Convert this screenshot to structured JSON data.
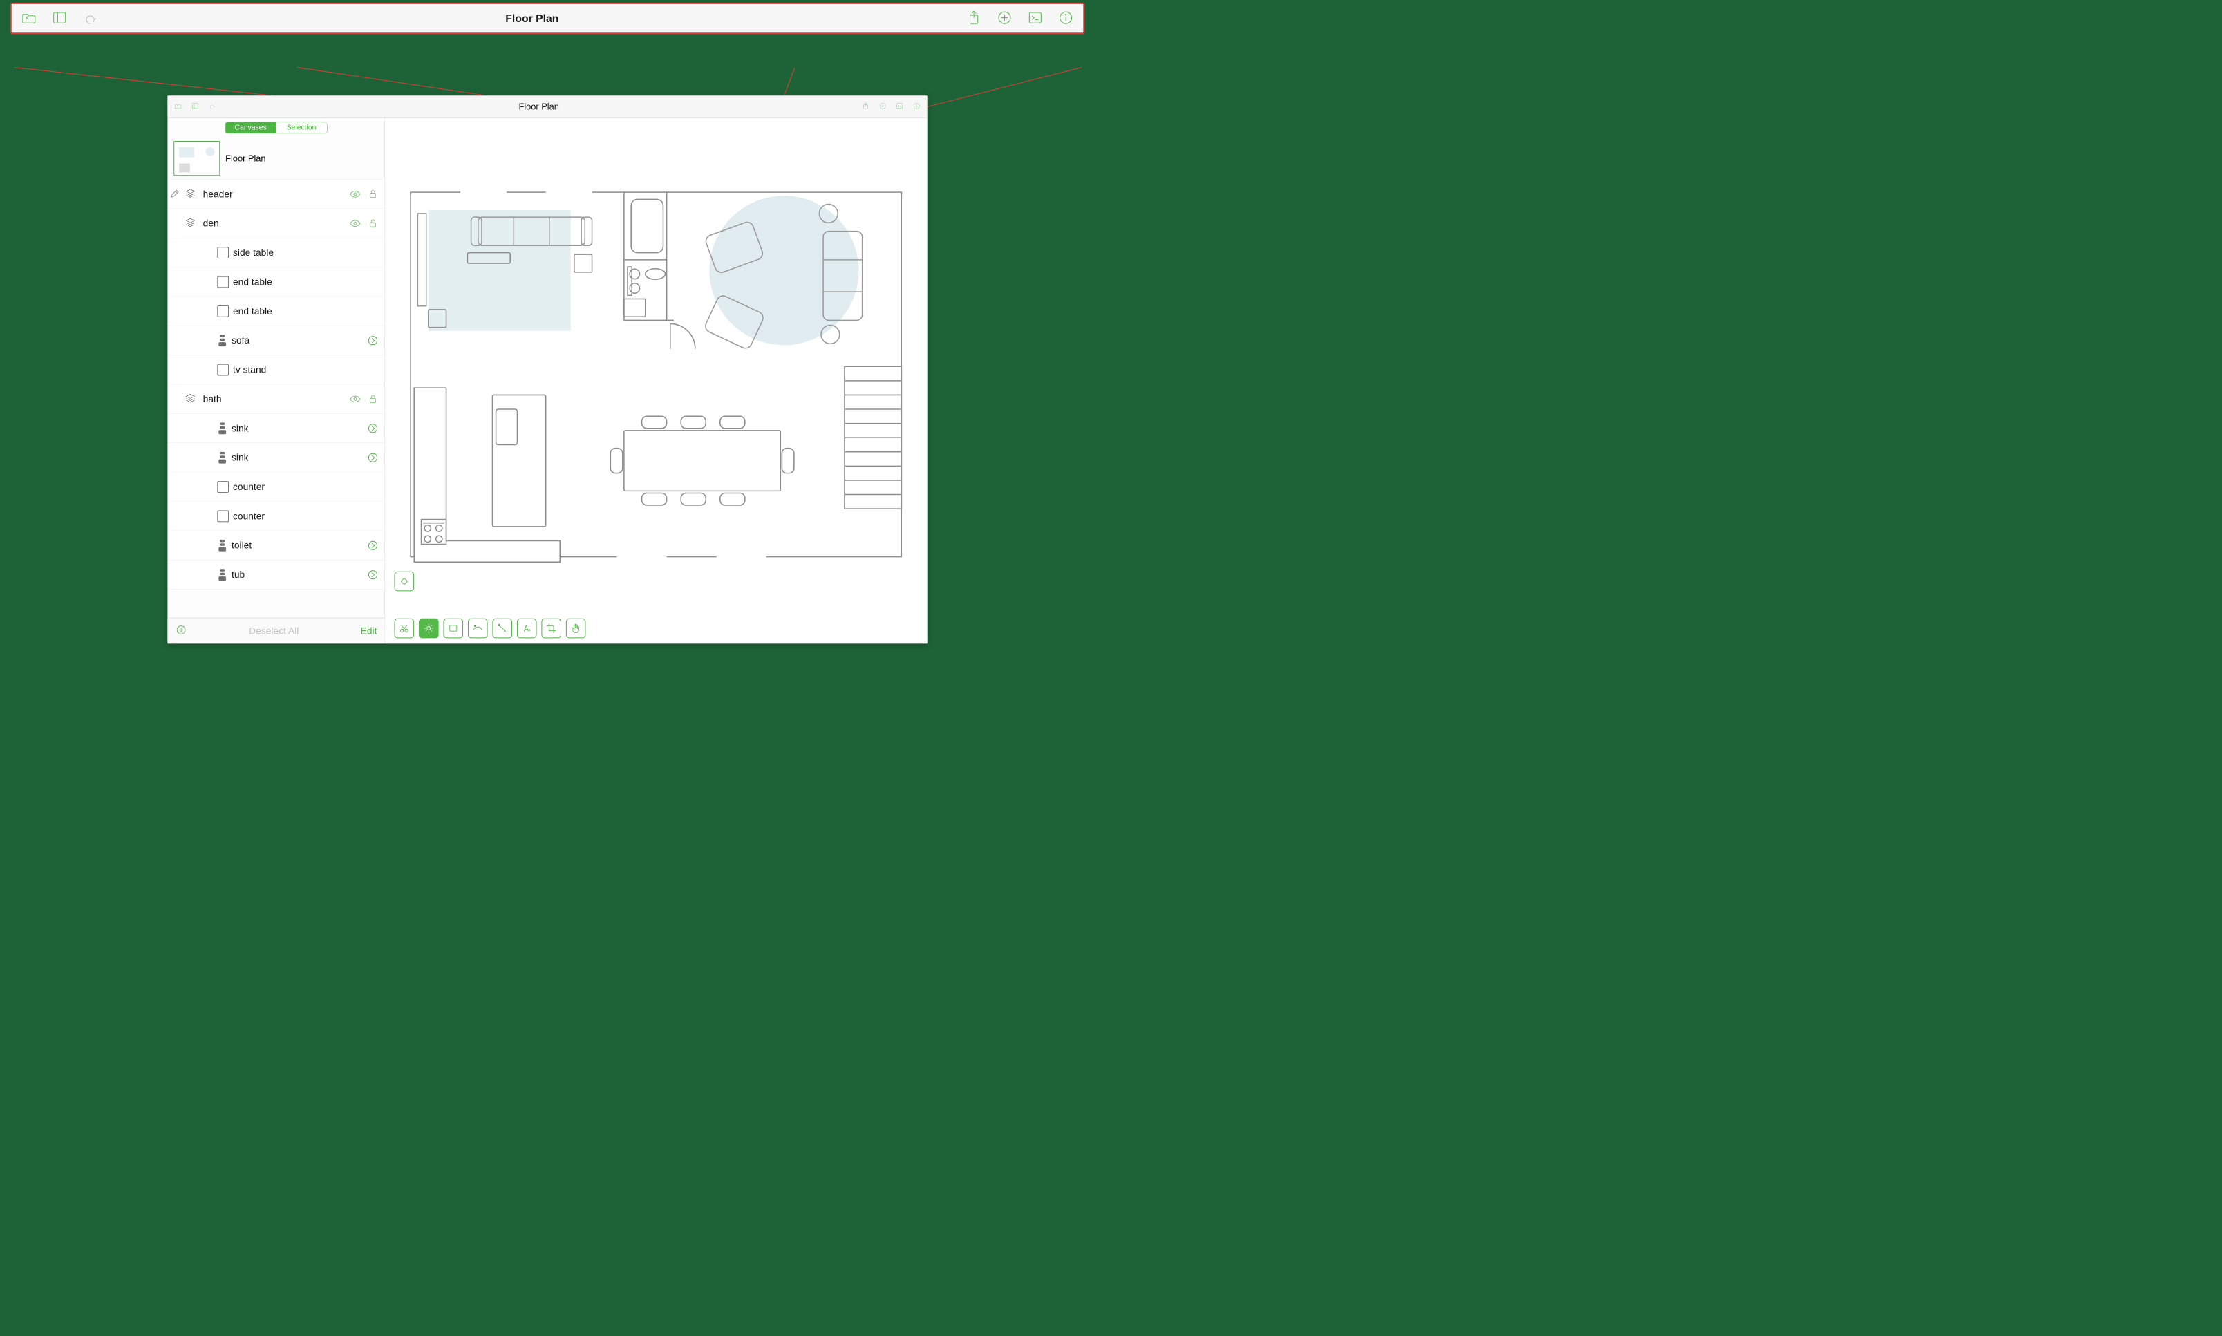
{
  "document_title": "Floor Plan",
  "segmented": {
    "tab_canvases": "Canvases",
    "tab_selection": "Selection",
    "active": "Canvases"
  },
  "canvas_preview_label": "Floor Plan",
  "layers": [
    {
      "kind": "layer",
      "label": "header",
      "depth": 0,
      "show_pencil": true
    },
    {
      "kind": "layer",
      "label": "den",
      "depth": 0
    },
    {
      "kind": "shape",
      "label": "side table",
      "depth": 2,
      "icon": "rect"
    },
    {
      "kind": "shape",
      "label": "end table",
      "depth": 2,
      "icon": "rect"
    },
    {
      "kind": "shape",
      "label": "end table",
      "depth": 2,
      "icon": "rect"
    },
    {
      "kind": "group",
      "label": "sofa",
      "depth": 2,
      "icon": "group",
      "chevron": true
    },
    {
      "kind": "shape",
      "label": "tv stand",
      "depth": 2,
      "icon": "rect"
    },
    {
      "kind": "layer",
      "label": "bath",
      "depth": 0
    },
    {
      "kind": "group",
      "label": "sink",
      "depth": 2,
      "icon": "group",
      "chevron": true
    },
    {
      "kind": "group",
      "label": "sink",
      "depth": 2,
      "icon": "group",
      "chevron": true
    },
    {
      "kind": "shape",
      "label": "counter",
      "depth": 2,
      "icon": "rect"
    },
    {
      "kind": "shape",
      "label": "counter",
      "depth": 2,
      "icon": "rect"
    },
    {
      "kind": "group",
      "label": "toilet",
      "depth": 2,
      "icon": "group",
      "chevron": true
    },
    {
      "kind": "group",
      "label": "tub",
      "depth": 2,
      "icon": "group",
      "chevron": true
    }
  ],
  "sidebar_footer": {
    "deselect_label": "Deselect All",
    "edit_label": "Edit"
  },
  "colors": {
    "accent": "#4cb441",
    "callout": "#d33f36"
  }
}
